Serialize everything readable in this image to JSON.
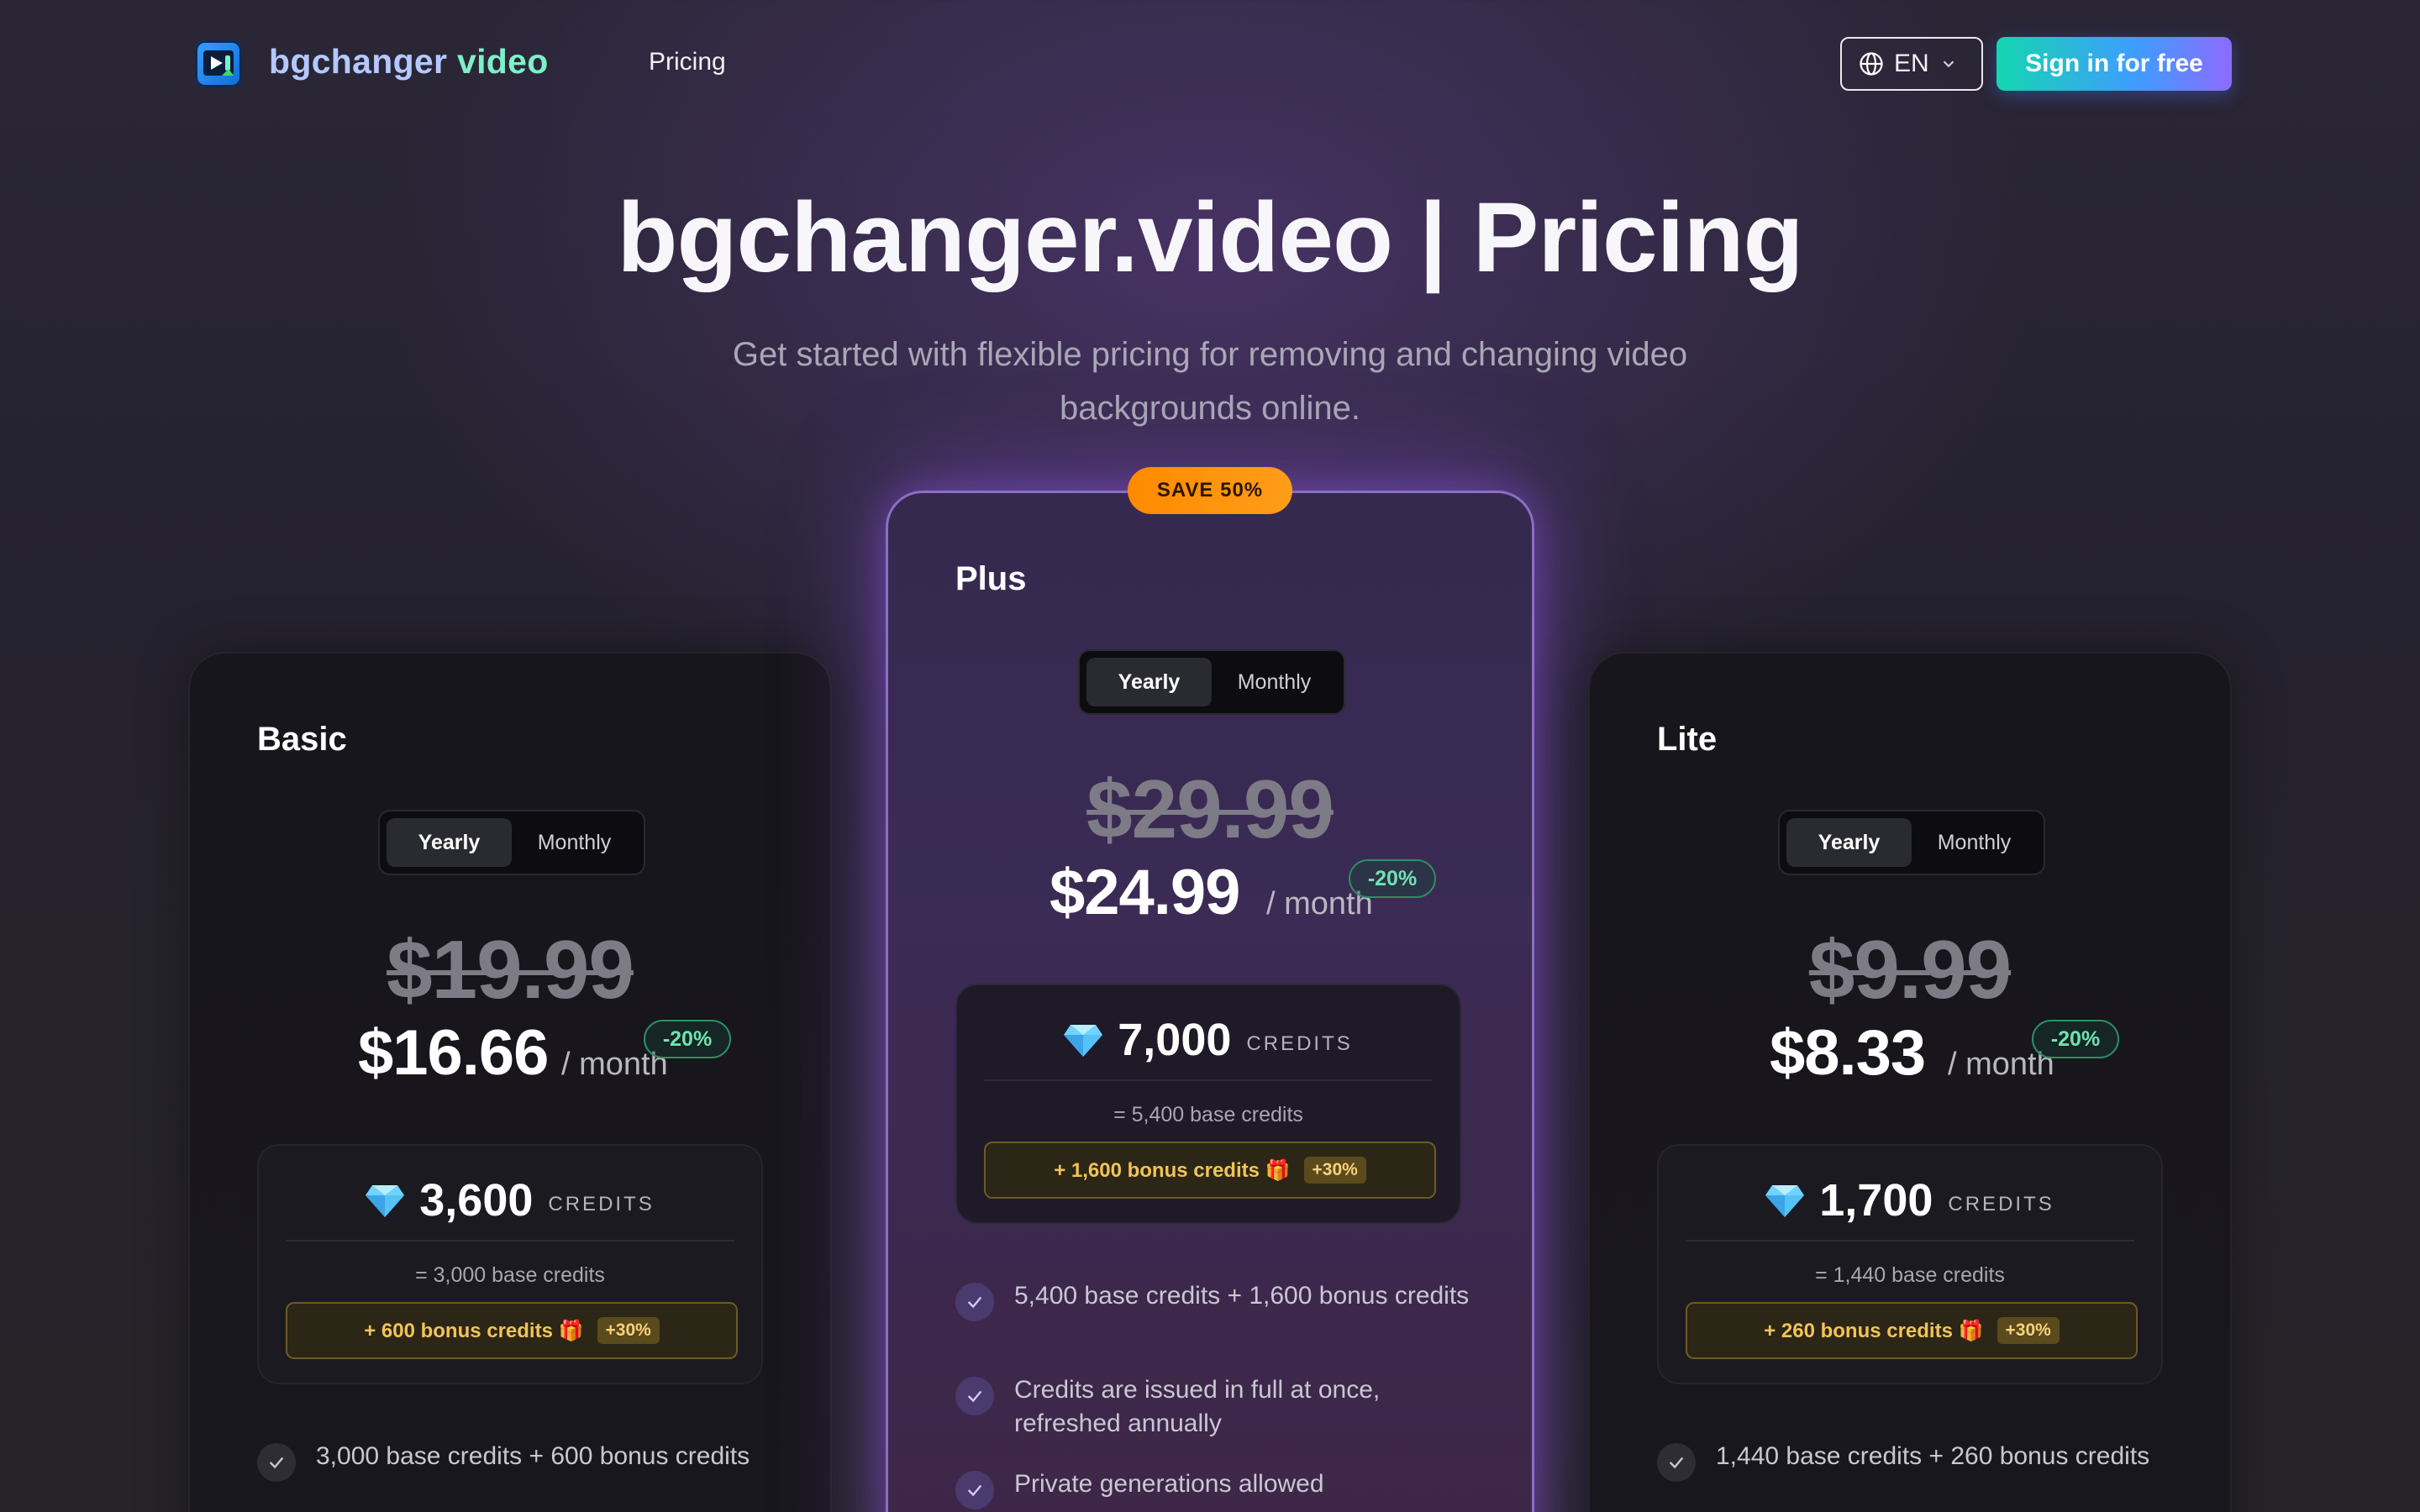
{
  "nav": {
    "brand_part1": "bgchanger",
    "brand_part2": "video",
    "pricing_link": "Pricing",
    "language": "EN",
    "signin_label": "Sign in for free"
  },
  "hero": {
    "title": "bgchanger.video | Pricing",
    "subtitle": "Get started with flexible pricing for removing and changing video backgrounds online."
  },
  "save_badge": "SAVE 50%",
  "colors": {
    "accent_gradient_start": "#14d6b0",
    "accent_gradient_end": "#8d6bff",
    "discount_green": "#6ee4b0",
    "bonus_gold": "#f2c357",
    "save_orange": "#ff8a00"
  },
  "plans": [
    {
      "name": "Basic",
      "toggle_yearly": "Yearly",
      "toggle_monthly": "Monthly",
      "selected_period": "Yearly",
      "old_price": "$19.99",
      "price": "$16.66",
      "per": "/ month",
      "discount": "-20%",
      "credits": "3,600",
      "credits_label": "CREDITS",
      "base_credits": "= 3,000 base credits",
      "bonus_credits": "+ 600 bonus credits 🎁",
      "bonus_pct": "+30%",
      "features": [
        "3,000 base credits + 600 bonus credits"
      ]
    },
    {
      "name": "Plus",
      "toggle_yearly": "Yearly",
      "toggle_monthly": "Monthly",
      "selected_period": "Yearly",
      "old_price": "$29.99",
      "price": "$24.99",
      "per": "/ month",
      "discount": "-20%",
      "credits": "7,000",
      "credits_label": "CREDITS",
      "base_credits": "= 5,400 base credits",
      "bonus_credits": "+ 1,600 bonus credits 🎁",
      "bonus_pct": "+30%",
      "features": [
        "5,400 base credits + 1,600 bonus credits",
        "Credits are issued in full at once, refreshed annually",
        "Private generations allowed"
      ]
    },
    {
      "name": "Lite",
      "toggle_yearly": "Yearly",
      "toggle_monthly": "Monthly",
      "selected_period": "Yearly",
      "old_price": "$9.99",
      "price": "$8.33",
      "per": "/ month",
      "discount": "-20%",
      "credits": "1,700",
      "credits_label": "CREDITS",
      "base_credits": "= 1,440 base credits",
      "bonus_credits": "+ 260 bonus credits 🎁",
      "bonus_pct": "+30%",
      "features": [
        "1,440 base credits + 260 bonus credits"
      ]
    }
  ]
}
